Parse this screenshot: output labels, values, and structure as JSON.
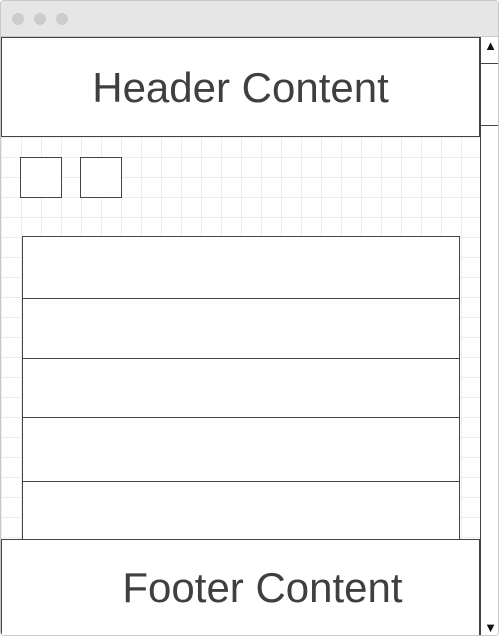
{
  "header": {
    "title": "Header Content"
  },
  "footer": {
    "title": "Footer Content"
  },
  "scrollbar": {
    "up_icon": "▲",
    "down_icon": "▼"
  },
  "list": {
    "row_count": 5
  },
  "colors": {
    "border": "#444444",
    "text": "#3f3f3f",
    "titlebar": "#e6e6e6",
    "grid": "#ececec"
  }
}
